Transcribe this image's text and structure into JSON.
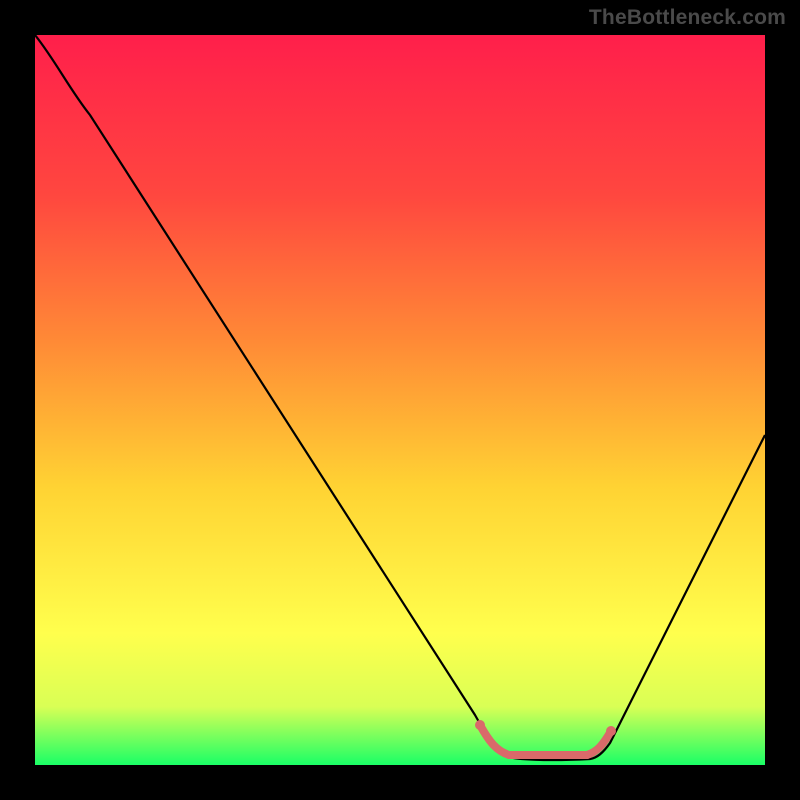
{
  "watermark": "TheBottleneck.com",
  "chart_data": {
    "type": "line",
    "title": "",
    "xlabel": "",
    "ylabel": "",
    "xlim": [
      0,
      100
    ],
    "ylim": [
      0,
      100
    ],
    "grid": false,
    "legend": false,
    "background_gradient": {
      "top": "#ff1f4b",
      "upper_mid": "#ff6a3a",
      "mid": "#ffd333",
      "lower_mid": "#ffff4d",
      "bottom": "#1aff66"
    },
    "series": [
      {
        "name": "bottleneck-curve",
        "color": "#000000",
        "x": [
          0,
          5,
          10,
          15,
          20,
          25,
          30,
          35,
          40,
          45,
          50,
          55,
          60,
          62,
          65,
          68,
          72,
          75,
          78,
          80,
          85,
          90,
          95,
          100
        ],
        "y": [
          100,
          95,
          88,
          80,
          72,
          64,
          56,
          48,
          40,
          32,
          24,
          16,
          8,
          4,
          1.5,
          0.8,
          0.8,
          1.5,
          4,
          8,
          16,
          26,
          36,
          46
        ]
      },
      {
        "name": "minimum-band",
        "type": "band",
        "color": "#d96a6a",
        "x": [
          62,
          78
        ],
        "y": [
          3,
          3
        ],
        "note": "flat accent segment at curve minimum"
      }
    ],
    "annotations": []
  }
}
